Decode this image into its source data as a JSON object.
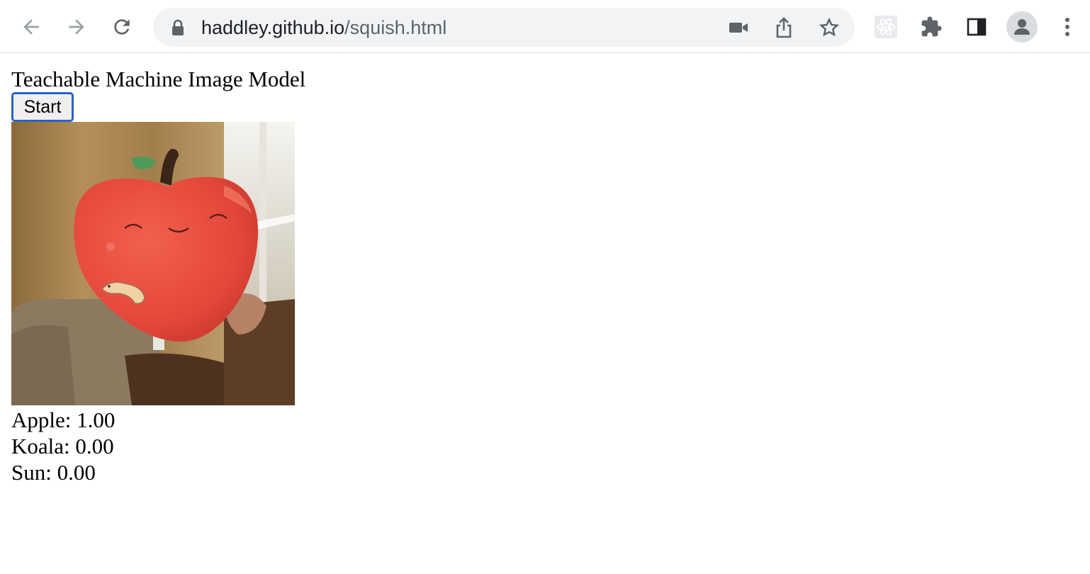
{
  "browser": {
    "url_host": "haddley.github.io",
    "url_path": "/squish.html"
  },
  "page": {
    "title": "Teachable Machine Image Model",
    "start_button": "Start"
  },
  "predictions": [
    {
      "text": "Apple: 1.00"
    },
    {
      "text": "Koala: 0.00"
    },
    {
      "text": "Sun: 0.00"
    }
  ],
  "webcam": {
    "subject": "red apple plush toy"
  },
  "colors": {
    "focus_ring": "#2b62c8",
    "omnibox_bg": "#f1f3f4",
    "apple_red": "#e8483a"
  }
}
